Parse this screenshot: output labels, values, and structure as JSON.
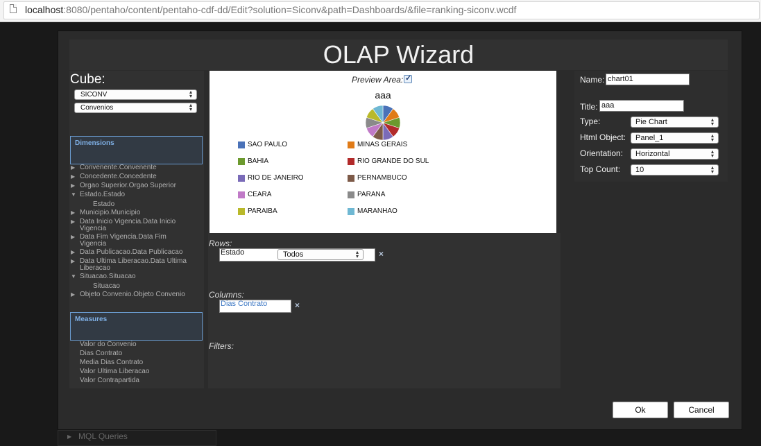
{
  "browser": {
    "url_host": "localhost",
    "url_rest": ":8080/pentaho/content/pentaho-cdf-dd/Edit?solution=Siconv&path=Dashboards/&file=ranking-siconv.wcdf"
  },
  "wizard": {
    "title": "OLAP Wizard",
    "cube_label": "Cube:",
    "cube_value": "SICONV",
    "catalog_value": "Convenios",
    "dimensions_header": "Dimensions",
    "measures_header": "Measures",
    "dimensions": [
      {
        "label": "Convenente.Convenente",
        "expanded": false,
        "children": []
      },
      {
        "label": "Concedente.Concedente",
        "expanded": false,
        "children": []
      },
      {
        "label": "Orgao Superior.Orgao Superior",
        "expanded": false,
        "children": []
      },
      {
        "label": "Estado.Estado",
        "expanded": true,
        "children": [
          "Estado"
        ]
      },
      {
        "label": "Municipio.Municipio",
        "expanded": false,
        "children": []
      },
      {
        "label": "Data Inicio Vigencia.Data Inicio Vigencia",
        "expanded": false,
        "children": []
      },
      {
        "label": "Data Fim Vigencia.Data Fim Vigencia",
        "expanded": false,
        "children": []
      },
      {
        "label": "Data Publicacao.Data Publicacao",
        "expanded": false,
        "children": []
      },
      {
        "label": "Data Ultima Liberacao.Data Ultima Liberacao",
        "expanded": false,
        "children": []
      },
      {
        "label": "Situacao.Situacao",
        "expanded": true,
        "children": [
          "Situacao"
        ]
      },
      {
        "label": "Objeto Convenio.Objeto Convenio",
        "expanded": false,
        "children": []
      }
    ],
    "measures": [
      "Valor do Convenio",
      "Dias Contrato",
      "Media Dias Contrato",
      "Valor Ultima Liberacao",
      "Valor Contrapartida"
    ],
    "preview_label": "Preview Area:",
    "preview_checked": true,
    "chart_title": "aaa",
    "legend": [
      {
        "label": "SAO PAULO",
        "color": "#4a72b8"
      },
      {
        "label": "MINAS GERAIS",
        "color": "#e07b18"
      },
      {
        "label": "BAHIA",
        "color": "#6c9a2e"
      },
      {
        "label": "RIO GRANDE DO SUL",
        "color": "#b22a2a"
      },
      {
        "label": "RIO DE JANEIRO",
        "color": "#7a6bb8"
      },
      {
        "label": "PERNAMBUCO",
        "color": "#7d5a48"
      },
      {
        "label": "CEARA",
        "color": "#c07ac7"
      },
      {
        "label": "PARANA",
        "color": "#8a8a8a"
      },
      {
        "label": "PARAIBA",
        "color": "#b9b92a"
      },
      {
        "label": "MARANHAO",
        "color": "#6fb8d3"
      }
    ],
    "rows_label": "Rows:",
    "rows_value": "Estado",
    "rows_filter": "Todos",
    "columns_label": "Columns:",
    "columns_value": "Dias Contrato",
    "filters_label": "Filters:",
    "remove_symbol": "×",
    "props": {
      "name_label": "Name:",
      "name_value": "chart01",
      "title_label": "Title:",
      "title_value": "aaa",
      "type_label": "Type:",
      "type_value": "Pie Chart",
      "html_label": "Html Object:",
      "html_value": "Panel_1",
      "orientation_label": "Orientation:",
      "orientation_value": "Horizontal",
      "topcount_label": "Top Count:",
      "topcount_value": "10"
    },
    "ok_label": "Ok",
    "cancel_label": "Cancel"
  },
  "footer": {
    "mql_label": "MQL Queries"
  }
}
